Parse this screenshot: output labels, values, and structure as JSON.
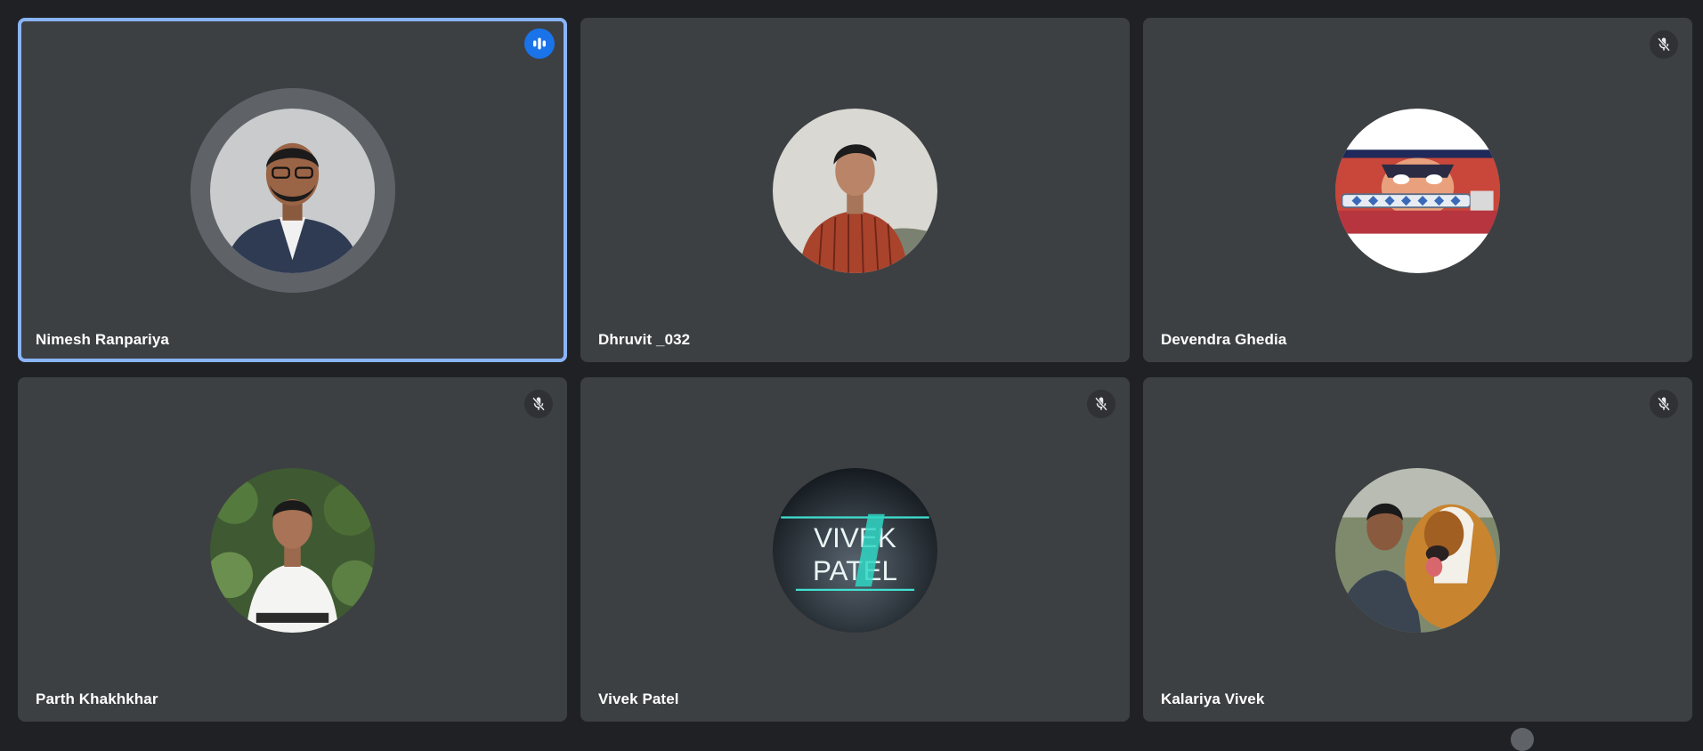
{
  "participants": [
    {
      "name": "Nimesh Ranpariya",
      "status": "speaking",
      "avatar": "avatar-photo-suit-man"
    },
    {
      "name": "Dhruvit _032",
      "status": "unmuted",
      "avatar": "avatar-photo-red-shirt"
    },
    {
      "name": "Devendra Ghedia",
      "status": "muted",
      "avatar": "avatar-anime-character"
    },
    {
      "name": "Parth Khakhkhar",
      "status": "muted",
      "avatar": "avatar-photo-white-shirt"
    },
    {
      "name": "Vivek Patel",
      "status": "muted",
      "avatar": "avatar-vivek-patel-logo"
    },
    {
      "name": "Kalariya Vivek",
      "status": "muted",
      "avatar": "avatar-photo-with-dog"
    }
  ],
  "logo_text": {
    "line1": "VIVEK",
    "line2": "PATEL"
  },
  "colors": {
    "background": "#202124",
    "tile": "#3c4043",
    "speaking_border": "#8ab4f8",
    "speaking_indicator": "#1a73e8"
  }
}
